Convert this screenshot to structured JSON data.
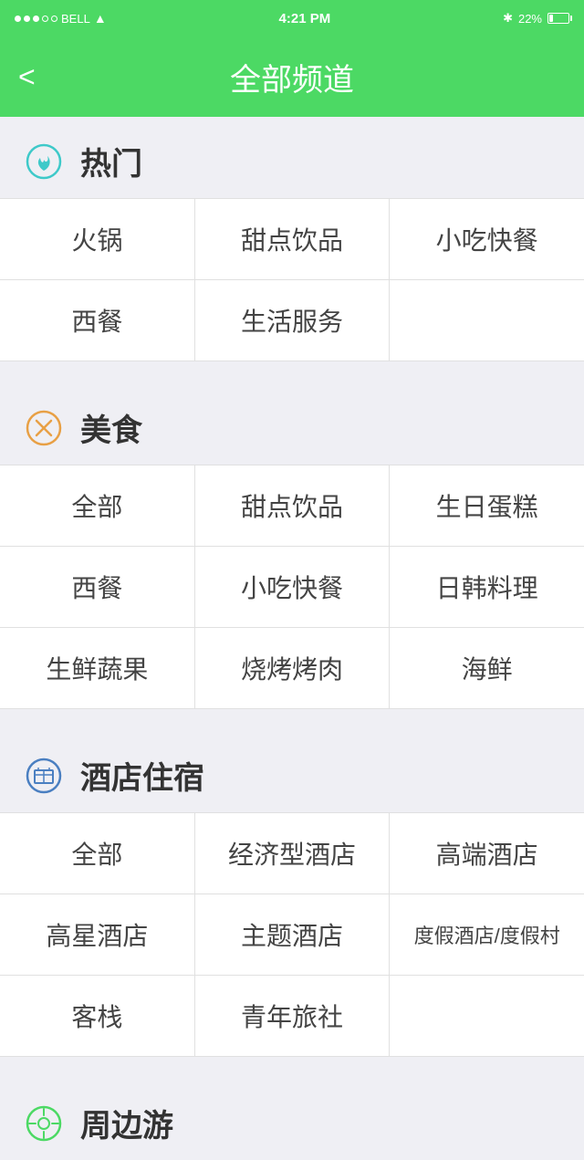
{
  "statusBar": {
    "carrier": "BELL",
    "time": "4:21 PM",
    "battery": "22%"
  },
  "navBar": {
    "back_label": "<",
    "title": "全部频道"
  },
  "sections": [
    {
      "id": "hot",
      "title": "热门",
      "iconType": "hot",
      "rows": [
        [
          "火锅",
          "甜点饮品",
          "小吃快餐"
        ],
        [
          "西餐",
          "生活服务",
          ""
        ]
      ]
    },
    {
      "id": "food",
      "title": "美食",
      "iconType": "food",
      "rows": [
        [
          "全部",
          "甜点饮品",
          "生日蛋糕"
        ],
        [
          "西餐",
          "小吃快餐",
          "日韩料理"
        ],
        [
          "生鲜蔬果",
          "烧烤烤肉",
          "海鲜"
        ]
      ]
    },
    {
      "id": "hotel",
      "title": "酒店住宿",
      "iconType": "hotel",
      "rows": [
        [
          "全部",
          "经济型酒店",
          "高端酒店"
        ],
        [
          "高星酒店",
          "主题酒店",
          "度假酒店/度假村"
        ],
        [
          "客栈",
          "青年旅社",
          ""
        ]
      ]
    },
    {
      "id": "nearby",
      "title": "周边游",
      "iconType": "nearby",
      "rows": []
    }
  ]
}
